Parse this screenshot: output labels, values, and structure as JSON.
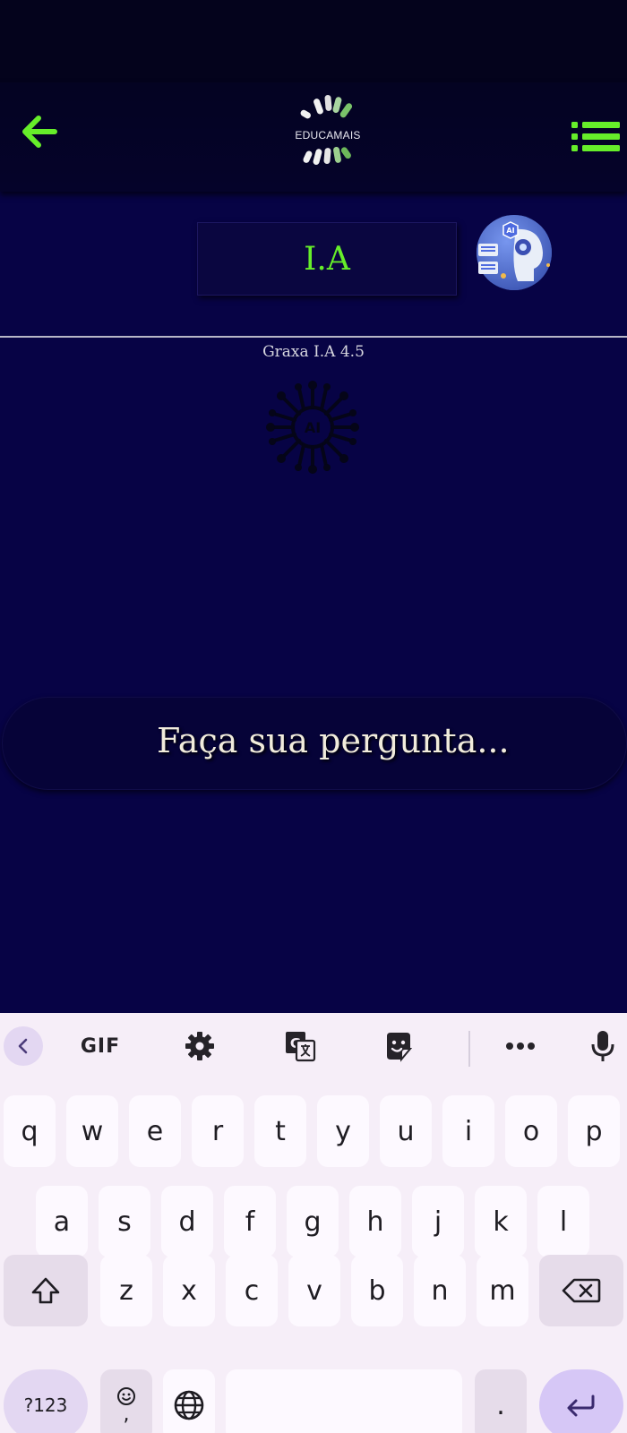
{
  "header": {
    "logo_text": "EDUCAMAIS"
  },
  "title": "I.A",
  "model_label": "Graxa I.A 4.5",
  "prompt": {
    "placeholder": "Faça sua pergunta..."
  },
  "keyboard": {
    "toolbar": {
      "gif_label": "GIF"
    },
    "row1": [
      "q",
      "w",
      "e",
      "r",
      "t",
      "y",
      "u",
      "i",
      "o",
      "p"
    ],
    "row2": [
      "a",
      "s",
      "d",
      "f",
      "g",
      "h",
      "j",
      "k",
      "l"
    ],
    "row3": [
      "z",
      "x",
      "c",
      "v",
      "b",
      "n",
      "m"
    ],
    "symbols_label": "?123",
    "comma_label": ",",
    "period_label": "."
  },
  "colors": {
    "background": "#070345",
    "header": "#04031c",
    "accent_green": "#66ee2a",
    "keyboard_bg": "#f6eef8",
    "keyboard_accent": "#d6c7f6"
  }
}
